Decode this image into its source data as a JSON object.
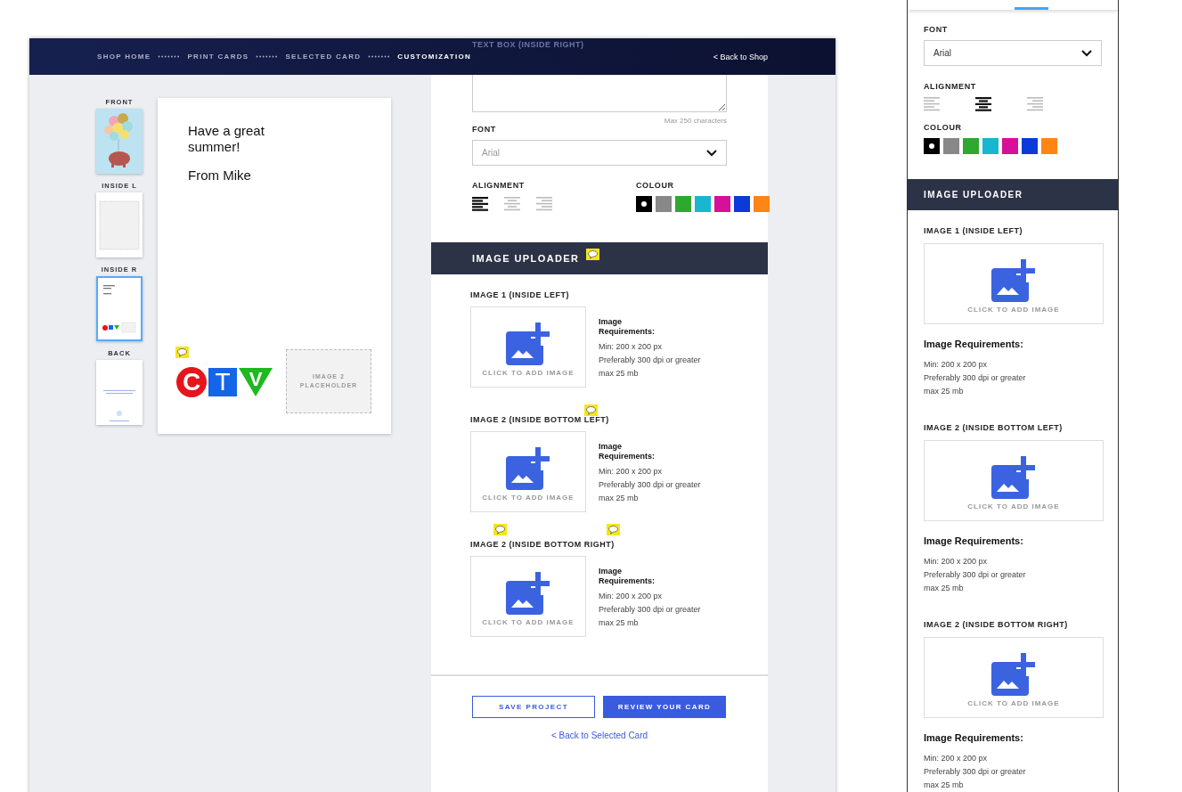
{
  "breadcrumb": [
    {
      "label": "SHOP HOME",
      "selected": false
    },
    {
      "label": "PRINT CARDS",
      "selected": false
    },
    {
      "label": "SELECTED CARD",
      "selected": false
    },
    {
      "label": "CUSTOMIZATION",
      "selected": true
    }
  ],
  "back_to_shop": "< Back to Shop",
  "pages": [
    {
      "label": "FRONT",
      "kind": "picture",
      "selected": false
    },
    {
      "label": "INSIDE L",
      "kind": "blank",
      "selected": false
    },
    {
      "label": "INSIDE R",
      "kind": "message",
      "selected": true
    },
    {
      "label": "BACK",
      "kind": "back",
      "selected": false
    }
  ],
  "preview": {
    "message": [
      "Have a great summer!",
      "From Mike"
    ],
    "logo_letters": [
      "C",
      "T",
      "V"
    ],
    "placeholder": "IMAGE 2 PLACEHOLDER"
  },
  "text_box": {
    "label": "TEXT BOX (INSIDE RIGHT)",
    "hint": "Max 250 characters"
  },
  "font": {
    "label": "FONT",
    "value": "Arial"
  },
  "alignment": {
    "label": "ALIGNMENT",
    "options": [
      {
        "kind": "left",
        "selected": true
      },
      {
        "kind": "center",
        "selected": false
      },
      {
        "kind": "right",
        "selected": false
      }
    ]
  },
  "colour": {
    "label": "COLOUR",
    "swatches": [
      {
        "color": "#000000",
        "selected": true
      },
      {
        "color": "#888888",
        "selected": false
      },
      {
        "color": "#2ea82e",
        "selected": false
      },
      {
        "color": "#18b6d0",
        "selected": false
      },
      {
        "color": "#d6109a",
        "selected": false
      },
      {
        "color": "#0a3ad8",
        "selected": false
      },
      {
        "color": "#ff8514",
        "selected": false
      }
    ]
  },
  "uploader": {
    "title": "IMAGE UPLOADER",
    "slots": [
      {
        "label": "IMAGE 1 (INSIDE LEFT)",
        "button": "CLICK TO ADD IMAGE",
        "requirements_title": "Image Requirements:",
        "requirements": [
          "Min: 200 x 200 px",
          "Preferably 300 dpi or greater",
          "max 25 mb"
        ]
      },
      {
        "label": "IMAGE 2 (INSIDE BOTTOM LEFT)",
        "button": "CLICK TO ADD IMAGE",
        "requirements_title": "Image Requirements:",
        "requirements": [
          "Min: 200 x 200 px",
          "Preferably 300 dpi or greater",
          "max 25 mb"
        ]
      },
      {
        "label": "IMAGE 2 (INSIDE BOTTOM RIGHT)",
        "button": "CLICK TO ADD IMAGE",
        "requirements_title": "Image Requirements:",
        "requirements": [
          "Min: 200 x 200 px",
          "Preferably 300 dpi or greater",
          "max 25 mb"
        ]
      }
    ]
  },
  "actions": {
    "save": "SAVE PROJECT",
    "review": "REVIEW YOUR CARD",
    "back": "< Back to Selected Card"
  },
  "mobile": {
    "tabs": [
      {
        "selected": false
      },
      {
        "selected": false
      },
      {
        "selected": true
      },
      {
        "selected": false
      }
    ],
    "font": {
      "label": "FONT",
      "value": "Arial"
    },
    "alignment": {
      "label": "ALIGNMENT",
      "options": [
        {
          "kind": "left",
          "selected": false
        },
        {
          "kind": "center",
          "selected": true
        },
        {
          "kind": "right",
          "selected": false
        }
      ]
    },
    "colour": {
      "label": "COLOUR",
      "swatches": [
        {
          "color": "#000000",
          "selected": true
        },
        {
          "color": "#888888",
          "selected": false
        },
        {
          "color": "#2ea82e",
          "selected": false
        },
        {
          "color": "#18b6d0",
          "selected": false
        },
        {
          "color": "#d6109a",
          "selected": false
        },
        {
          "color": "#0a3ad8",
          "selected": false
        },
        {
          "color": "#ff8514",
          "selected": false
        }
      ]
    },
    "uploader": {
      "title": "IMAGE UPLOADER",
      "slots": [
        {
          "label": "IMAGE 1 (INSIDE LEFT)",
          "button": "CLICK TO ADD IMAGE",
          "requirements_title": "Image Requirements:",
          "requirements": [
            "Min: 200 x 200 px",
            "Preferably 300 dpi or greater",
            "max 25 mb"
          ]
        },
        {
          "label": "IMAGE 2 (INSIDE BOTTOM LEFT)",
          "button": "CLICK TO ADD IMAGE",
          "requirements_title": "Image Requirements:",
          "requirements": [
            "Min: 200 x 200 px",
            "Preferably 300 dpi or greater",
            "max 25 mb"
          ]
        },
        {
          "label": "IMAGE 2 (INSIDE BOTTOM RIGHT)",
          "button": "CLICK TO ADD IMAGE",
          "requirements_title": "Image Requirements:",
          "requirements": [
            "Min: 200 x 200 px",
            "Preferably 300 dpi or greater",
            "max 25 mb"
          ]
        }
      ]
    }
  }
}
